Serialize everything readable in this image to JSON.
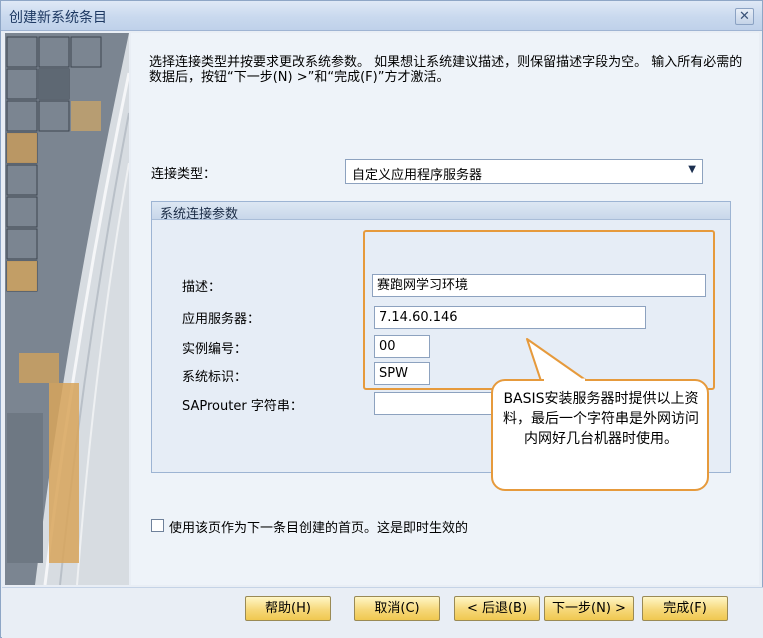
{
  "window": {
    "title": "创建新系统条目",
    "close_glyph": "✕"
  },
  "instructions": "选择连接类型并按要求更改系统参数。 如果想让系统建议描述，则保留描述字段为空。 输入所有必需的数据后，按钮“下一步(N) >”和“完成(F)”方才激活。",
  "connection": {
    "label": "连接类型：",
    "selected": "自定义应用程序服务器",
    "arrow": "▼"
  },
  "params": {
    "group_title": "系统连接参数",
    "description": {
      "label": "描述：",
      "value": "赛跑网学习环境"
    },
    "app_server": {
      "label": "应用服务器：",
      "value": "7.14.60.146"
    },
    "instance": {
      "label": "实例编号：",
      "value": "00"
    },
    "system_id": {
      "label": "系统标识：",
      "value": "SPW"
    },
    "saprouter": {
      "label": "SAProuter 字符串：",
      "value": ""
    }
  },
  "callout": {
    "text": "BASIS安装服务器时提供以上资料，最后一个字符串是外网访问内网好几台机器时使用。"
  },
  "checkbox": {
    "label": "使用该页作为下一条目创建的首页。这是即时生效的",
    "checked": false
  },
  "buttons": {
    "help": "帮助(H)",
    "cancel": "取消(C)",
    "back": "< 后退(B)",
    "next": "下一步(N) >",
    "finish": "完成(F)"
  },
  "colors": {
    "accent_orange": "#e69a3c",
    "button_gold": "#f6d87a"
  }
}
